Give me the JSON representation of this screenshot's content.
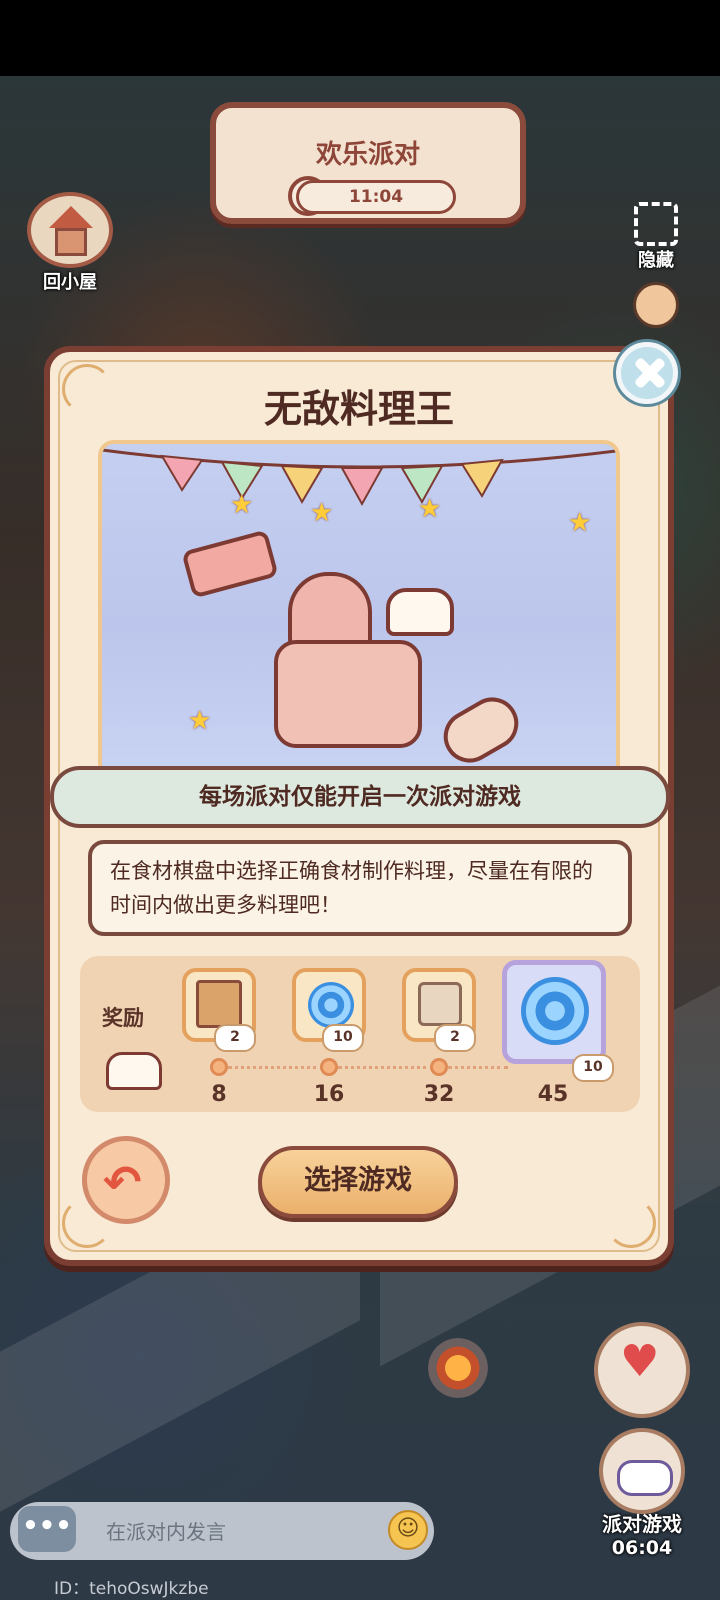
{
  "top_banner": {
    "title": "欢乐派对",
    "timer": "11:04"
  },
  "side_buttons": {
    "home": "回小屋",
    "hide": "隐藏"
  },
  "dialog": {
    "title": "无敌料理王",
    "notice": "每场派对仅能开启一次派对游戏",
    "description": "在食材棋盘中选择正确食材制作料理，尽量在有限的时间内做出更多料理吧！",
    "rewards": {
      "label": "奖励",
      "milestones": [
        {
          "score": "8",
          "item_icon": "book-icon",
          "count": "2"
        },
        {
          "score": "16",
          "item_icon": "swirl-icon",
          "count": "10"
        },
        {
          "score": "32",
          "item_icon": "scroll-icon",
          "count": "2"
        },
        {
          "score": "45",
          "item_icon": "swirl-icon",
          "count": "10"
        }
      ]
    },
    "select_button": "选择游戏"
  },
  "chat": {
    "placeholder": "在派对内发言",
    "chat_icon_text": "•••",
    "emoji": "☺"
  },
  "user_id": "ID：tehoOswJkzbe",
  "party_game": {
    "label": "派对游戏",
    "timer": "06:04"
  },
  "colors": {
    "dialog_bg": "#f8ead5",
    "dialog_border": "#7b3e33",
    "notice_bg": "#dde9df",
    "button": "#eab06b"
  }
}
